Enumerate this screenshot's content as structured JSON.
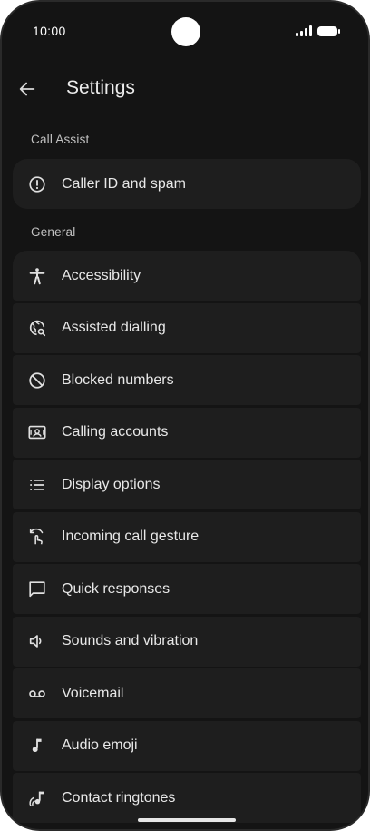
{
  "status_bar": {
    "time": "10:00",
    "icons": [
      "signal-icon",
      "battery-icon"
    ]
  },
  "app_bar": {
    "back_icon": "arrow-back-icon",
    "title": "Settings"
  },
  "sections": [
    {
      "header": "Call Assist",
      "items": [
        {
          "label": "Caller ID and spam",
          "icon": "info-alert-icon"
        }
      ]
    },
    {
      "header": "General",
      "items": [
        {
          "label": "Accessibility",
          "icon": "accessibility-icon"
        },
        {
          "label": "Assisted dialling",
          "icon": "globe-search-icon"
        },
        {
          "label": "Blocked numbers",
          "icon": "block-icon"
        },
        {
          "label": "Calling accounts",
          "icon": "account-card-icon"
        },
        {
          "label": "Display options",
          "icon": "list-icon"
        },
        {
          "label": "Incoming call gesture",
          "icon": "gesture-icon"
        },
        {
          "label": "Quick responses",
          "icon": "chat-bubble-icon"
        },
        {
          "label": "Sounds and vibration",
          "icon": "volume-icon"
        },
        {
          "label": "Voicemail",
          "icon": "voicemail-icon"
        },
        {
          "label": "Audio emoji",
          "icon": "music-note-icon"
        },
        {
          "label": "Contact ringtones",
          "icon": "ringtone-icon"
        }
      ]
    }
  ],
  "colors": {
    "background": "#141414",
    "card": "#1e1e1e",
    "text": "#e8e8e8",
    "section_text": "#c2c2c2"
  }
}
